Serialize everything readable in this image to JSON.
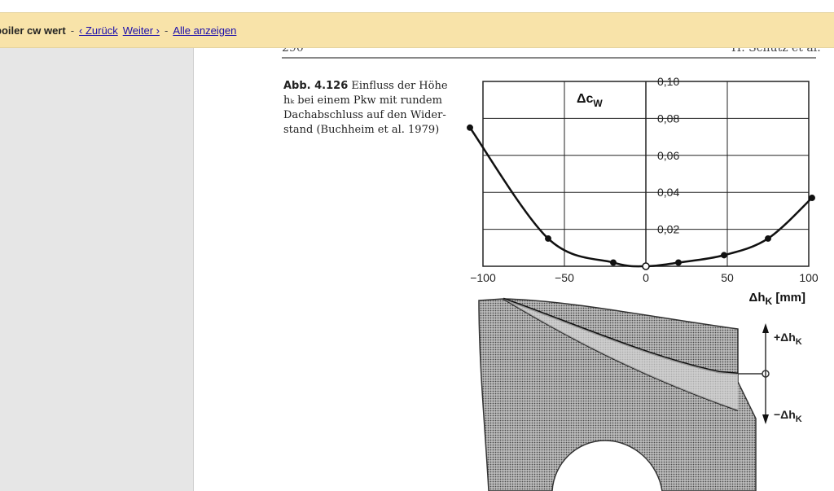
{
  "find_bar": {
    "query": "poiler cw wert",
    "separator": "-",
    "prev_label": "‹ Zurück",
    "next_label": "Weiter ›",
    "show_all_label": "Alle anzeigen"
  },
  "page": {
    "page_number": "290",
    "author": "H. Schütz et al.",
    "caption_label": "Abb. 4.126",
    "caption_text": "Einfluss der Höhe hₖ bei einem Pkw mit rundem Dachabschluss auf den Wider-stand (Buchheim et al. 1979)"
  },
  "chart_data": {
    "type": "scatter",
    "ylabel": "Δc_W",
    "xlabel": "Δh_K [mm]",
    "x_ticks": [
      "−100",
      "−50",
      "0",
      "50",
      "100"
    ],
    "y_ticks": [
      "0,02",
      "0,04",
      "0,06",
      "0,08",
      "0,10"
    ],
    "xlim": [
      -100,
      100
    ],
    "ylim": [
      0,
      0.1
    ],
    "grid": true,
    "series": [
      {
        "points": [
          [
            -108,
            0.075
          ],
          [
            -60,
            0.015
          ],
          [
            -20,
            0.002
          ],
          [
            0,
            0.0
          ],
          [
            20,
            0.002
          ],
          [
            48,
            0.006
          ],
          [
            75,
            0.015
          ],
          [
            102,
            0.037
          ]
        ]
      }
    ],
    "origin_marker": [
      0,
      0
    ]
  },
  "diagram": {
    "plus_label": "+Δh",
    "minus_label": "−Δh",
    "subscript": "K"
  }
}
